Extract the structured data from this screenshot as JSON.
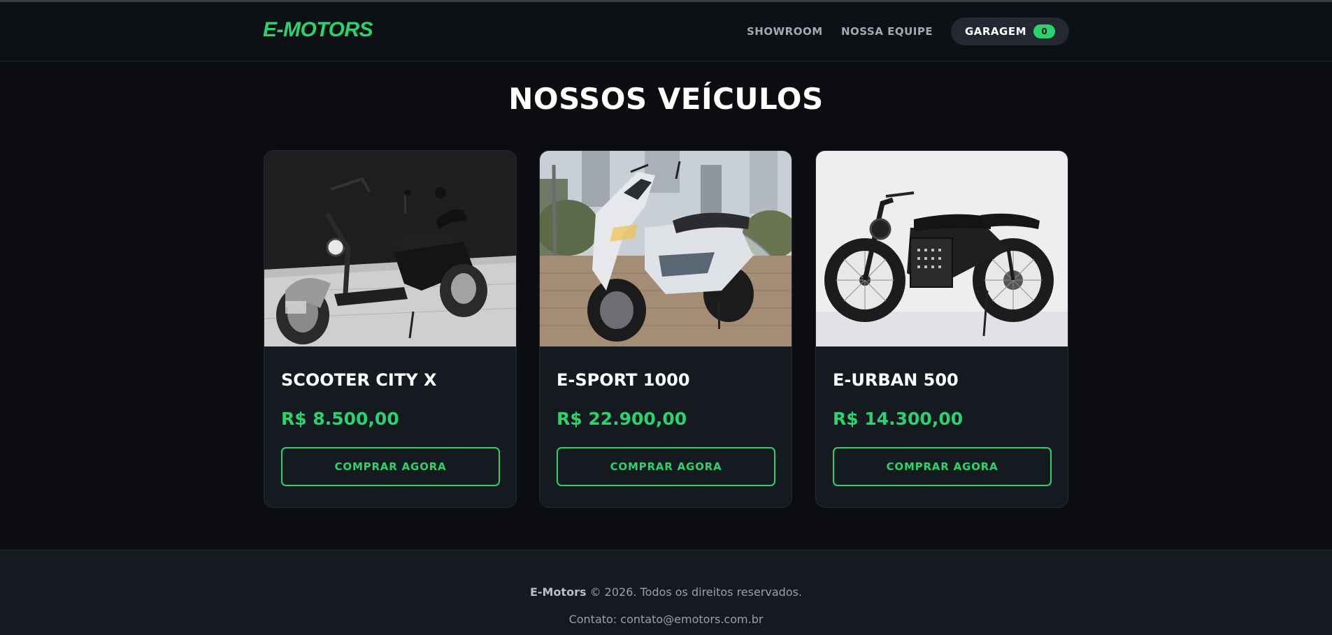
{
  "header": {
    "logo": "E-MOTORS",
    "nav": [
      {
        "label": "SHOWROOM"
      },
      {
        "label": "NOSSA EQUIPE"
      }
    ],
    "garage": {
      "label": "GARAGEM",
      "count": "0"
    }
  },
  "main": {
    "title": "NOSSOS VEÍCULOS",
    "products": [
      {
        "name": "SCOOTER CITY X",
        "price": "R$ 8.500,00",
        "button": "COMPRAR AGORA",
        "image_icon": "scooter-photo"
      },
      {
        "name": "E-SPORT 1000",
        "price": "R$ 22.900,00",
        "button": "COMPRAR AGORA",
        "image_icon": "sport-scooter-photo"
      },
      {
        "name": "E-URBAN 500",
        "price": "R$ 14.300,00",
        "button": "COMPRAR AGORA",
        "image_icon": "urban-ebike-photo"
      }
    ]
  },
  "footer": {
    "brand": "E-Motors",
    "copyright": "© 2026. Todos os direitos reservados.",
    "contact": "Contato: contato@emotors.com.br"
  },
  "colors": {
    "accent": "#2bd36e",
    "background": "#0b0d11",
    "card": "#151920",
    "badge_bg": "#232833"
  }
}
